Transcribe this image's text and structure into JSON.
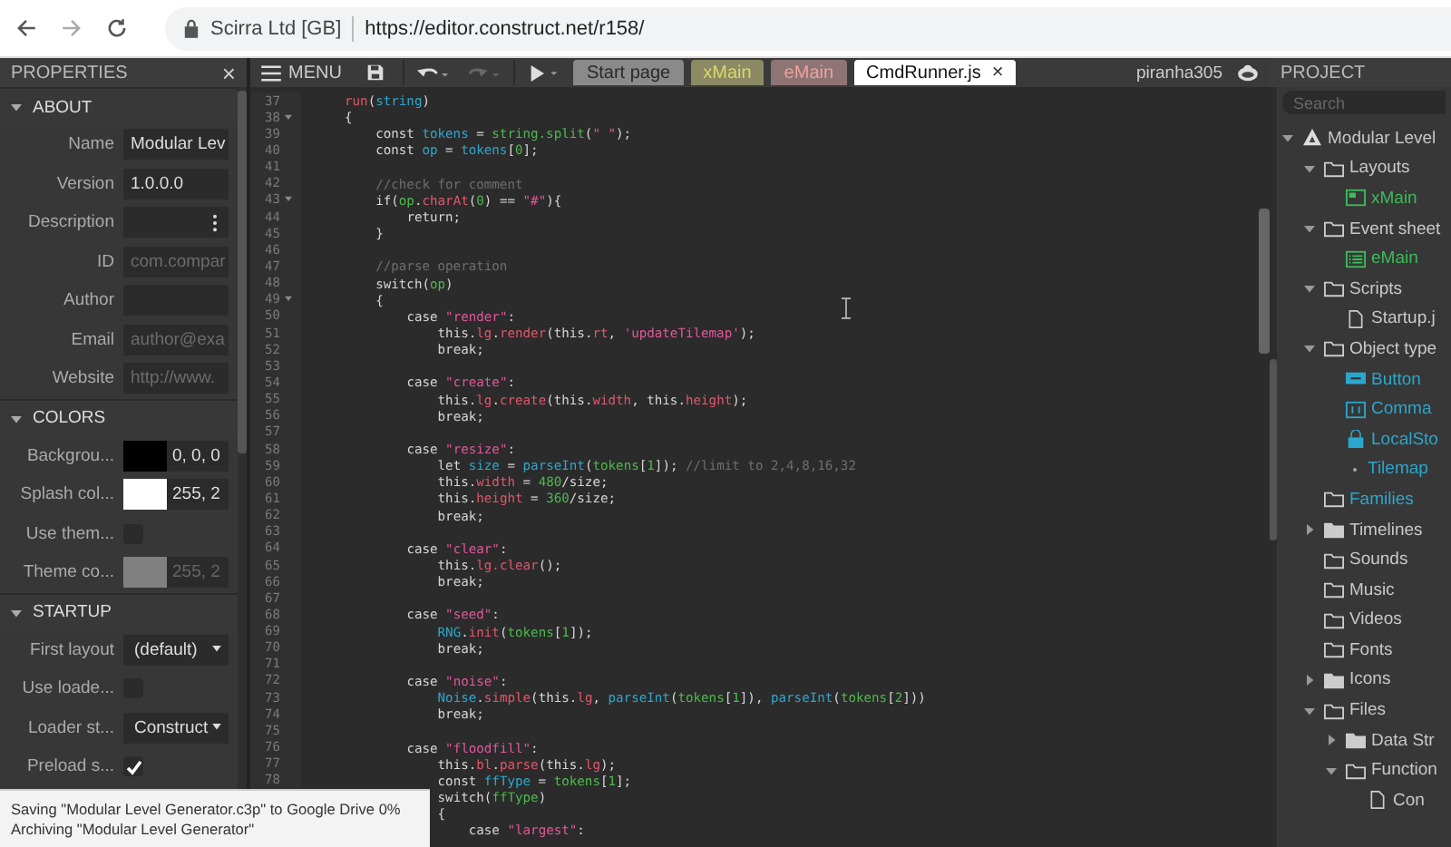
{
  "browser": {
    "site": "Scirra Ltd [GB]",
    "url": "https://editor.construct.net/r158/"
  },
  "properties": {
    "title": "PROPERTIES",
    "close": "×",
    "sections": [
      {
        "title": "ABOUT",
        "expanded": true,
        "rows": [
          {
            "label": "Name",
            "kind": "text",
            "value": "Modular Lev"
          },
          {
            "label": "Version",
            "kind": "text",
            "value": "1.0.0.0"
          },
          {
            "label": "Description",
            "kind": "menu"
          },
          {
            "label": "ID",
            "kind": "text",
            "placeholder": "com.compar"
          },
          {
            "label": "Author",
            "kind": "text"
          },
          {
            "label": "Email",
            "kind": "text",
            "placeholder": "author@exa"
          },
          {
            "label": "Website",
            "kind": "text",
            "placeholder": "http://www."
          }
        ]
      },
      {
        "title": "COLORS",
        "expanded": true,
        "rows": [
          {
            "label": "Backgrou...",
            "kind": "color",
            "color": "#000000",
            "value": "0, 0, 0",
            "disabled": false
          },
          {
            "label": "Splash col...",
            "kind": "color",
            "color": "#ffffff",
            "value": "255, 2",
            "disabled": false
          },
          {
            "label": "Use them...",
            "kind": "checkbox",
            "checked": false
          },
          {
            "label": "Theme co...",
            "kind": "color",
            "color": "#808080",
            "value": "255, 2",
            "disabled": true
          }
        ]
      },
      {
        "title": "STARTUP",
        "expanded": true,
        "rows": [
          {
            "label": "First layout",
            "kind": "dropdown",
            "value": "(default)"
          },
          {
            "label": "Use loade...",
            "kind": "checkbox",
            "checked": false
          },
          {
            "label": "Loader st...",
            "kind": "dropdown",
            "value": "Construct"
          },
          {
            "label": "Preload s...",
            "kind": "checkbox",
            "checked": true
          }
        ]
      }
    ]
  },
  "toolbar": {
    "menu": "MENU",
    "undo_enabled": true,
    "redo_enabled": false
  },
  "tabs": [
    {
      "label": "Start page",
      "kind": "page",
      "selected": false
    },
    {
      "label": "xMain",
      "kind": "layout",
      "selected": false
    },
    {
      "label": "eMain",
      "kind": "eventsheet",
      "selected": false
    },
    {
      "label": "CmdRunner.js",
      "kind": "script",
      "selected": true,
      "close": "×"
    }
  ],
  "user": "piranha305",
  "code": [
    {
      "number": "37",
      "tokens": [
        {
          "kind": "member",
          "text": "run"
        },
        {
          "kind": "plain",
          "text": "("
        },
        {
          "kind": "identifier",
          "text": "string"
        },
        {
          "kind": "plain",
          "text": ")"
        }
      ]
    },
    {
      "number": "38",
      "fold": true,
      "tokens": [
        {
          "kind": "plain",
          "text": "{"
        }
      ]
    },
    {
      "number": "39",
      "tokens": [
        {
          "kind": "plain",
          "text": "    const "
        },
        {
          "kind": "identifier",
          "text": "tokens"
        },
        {
          "kind": "plain",
          "text": " = "
        },
        {
          "kind": "reference",
          "text": "string.split"
        },
        {
          "kind": "plain",
          "text": "("
        },
        {
          "kind": "string",
          "text": "\" \""
        },
        {
          "kind": "plain",
          "text": ");"
        }
      ]
    },
    {
      "number": "40",
      "tokens": [
        {
          "kind": "plain",
          "text": "    const "
        },
        {
          "kind": "identifier",
          "text": "op"
        },
        {
          "kind": "plain",
          "text": " = "
        },
        {
          "kind": "identifier",
          "text": "tokens"
        },
        {
          "kind": "plain",
          "text": "["
        },
        {
          "kind": "number",
          "text": "0"
        },
        {
          "kind": "plain",
          "text": "];"
        }
      ]
    },
    {
      "number": "41"
    },
    {
      "number": "42",
      "tokens": [
        {
          "kind": "comment",
          "text": "    //check for comment"
        }
      ]
    },
    {
      "number": "43",
      "fold": true,
      "tokens": [
        {
          "kind": "plain",
          "text": "    if("
        },
        {
          "kind": "reference",
          "text": "op"
        },
        {
          "kind": "plain",
          "text": "."
        },
        {
          "kind": "member",
          "text": "charAt"
        },
        {
          "kind": "plain",
          "text": "("
        },
        {
          "kind": "number",
          "text": "0"
        },
        {
          "kind": "plain",
          "text": ") == "
        },
        {
          "kind": "string",
          "text": "\"#\""
        },
        {
          "kind": "plain",
          "text": "){"
        }
      ]
    },
    {
      "number": "44",
      "tokens": [
        {
          "kind": "plain",
          "text": "        return;"
        }
      ]
    },
    {
      "number": "45",
      "tokens": [
        {
          "kind": "plain",
          "text": "    }"
        }
      ]
    },
    {
      "number": "46"
    },
    {
      "number": "47",
      "tokens": [
        {
          "kind": "comment",
          "text": "    //parse operation"
        }
      ]
    },
    {
      "number": "48",
      "tokens": [
        {
          "kind": "plain",
          "text": "    switch("
        },
        {
          "kind": "reference",
          "text": "op"
        },
        {
          "kind": "plain",
          "text": ")"
        }
      ]
    },
    {
      "number": "49",
      "fold": true,
      "tokens": [
        {
          "kind": "plain",
          "text": "    {"
        }
      ]
    },
    {
      "number": "50",
      "tokens": [
        {
          "kind": "plain",
          "text": "        case "
        },
        {
          "kind": "string",
          "text": "\"render\""
        },
        {
          "kind": "plain",
          "text": ":"
        }
      ]
    },
    {
      "number": "51",
      "tokens": [
        {
          "kind": "plain",
          "text": "            this."
        },
        {
          "kind": "member",
          "text": "lg"
        },
        {
          "kind": "plain",
          "text": "."
        },
        {
          "kind": "member",
          "text": "render"
        },
        {
          "kind": "plain",
          "text": "(this."
        },
        {
          "kind": "member",
          "text": "rt"
        },
        {
          "kind": "plain",
          "text": ", "
        },
        {
          "kind": "string",
          "text": "'updateTilemap'"
        },
        {
          "kind": "plain",
          "text": ");"
        }
      ]
    },
    {
      "number": "52",
      "tokens": [
        {
          "kind": "plain",
          "text": "            break;"
        }
      ]
    },
    {
      "number": "53"
    },
    {
      "number": "54",
      "tokens": [
        {
          "kind": "plain",
          "text": "        case "
        },
        {
          "kind": "string",
          "text": "\"create\""
        },
        {
          "kind": "plain",
          "text": ":"
        }
      ]
    },
    {
      "number": "55",
      "tokens": [
        {
          "kind": "plain",
          "text": "            this."
        },
        {
          "kind": "member",
          "text": "lg"
        },
        {
          "kind": "plain",
          "text": "."
        },
        {
          "kind": "member",
          "text": "create"
        },
        {
          "kind": "plain",
          "text": "(this."
        },
        {
          "kind": "member",
          "text": "width"
        },
        {
          "kind": "plain",
          "text": ", this."
        },
        {
          "kind": "member",
          "text": "height"
        },
        {
          "kind": "plain",
          "text": ");"
        }
      ]
    },
    {
      "number": "56",
      "tokens": [
        {
          "kind": "plain",
          "text": "            break;"
        }
      ]
    },
    {
      "number": "57"
    },
    {
      "number": "58",
      "tokens": [
        {
          "kind": "plain",
          "text": "        case "
        },
        {
          "kind": "string",
          "text": "\"resize\""
        },
        {
          "kind": "plain",
          "text": ":"
        }
      ]
    },
    {
      "number": "59",
      "tokens": [
        {
          "kind": "plain",
          "text": "            let "
        },
        {
          "kind": "identifier",
          "text": "size"
        },
        {
          "kind": "plain",
          "text": " = "
        },
        {
          "kind": "identifier",
          "text": "parseInt"
        },
        {
          "kind": "plain",
          "text": "("
        },
        {
          "kind": "reference",
          "text": "tokens"
        },
        {
          "kind": "plain",
          "text": "["
        },
        {
          "kind": "number",
          "text": "1"
        },
        {
          "kind": "plain",
          "text": "]); "
        },
        {
          "kind": "comment",
          "text": "//limit to 2,4,8,16,32"
        }
      ]
    },
    {
      "number": "60",
      "tokens": [
        {
          "kind": "plain",
          "text": "            this."
        },
        {
          "kind": "member",
          "text": "width"
        },
        {
          "kind": "plain",
          "text": " = "
        },
        {
          "kind": "number",
          "text": "480"
        },
        {
          "kind": "plain",
          "text": "/size;"
        }
      ]
    },
    {
      "number": "61",
      "tokens": [
        {
          "kind": "plain",
          "text": "            this."
        },
        {
          "kind": "member",
          "text": "height"
        },
        {
          "kind": "plain",
          "text": " = "
        },
        {
          "kind": "number",
          "text": "360"
        },
        {
          "kind": "plain",
          "text": "/size;"
        }
      ]
    },
    {
      "number": "62",
      "tokens": [
        {
          "kind": "plain",
          "text": "            break;"
        }
      ]
    },
    {
      "number": "63"
    },
    {
      "number": "64",
      "tokens": [
        {
          "kind": "plain",
          "text": "        case "
        },
        {
          "kind": "string",
          "text": "\"clear\""
        },
        {
          "kind": "plain",
          "text": ":"
        }
      ]
    },
    {
      "number": "65",
      "tokens": [
        {
          "kind": "plain",
          "text": "            this."
        },
        {
          "kind": "member",
          "text": "lg.clear"
        },
        {
          "kind": "plain",
          "text": "();"
        }
      ]
    },
    {
      "number": "66",
      "tokens": [
        {
          "kind": "plain",
          "text": "            break;"
        }
      ]
    },
    {
      "number": "67"
    },
    {
      "number": "68",
      "tokens": [
        {
          "kind": "plain",
          "text": "        case "
        },
        {
          "kind": "string",
          "text": "\"seed\""
        },
        {
          "kind": "plain",
          "text": ":"
        }
      ]
    },
    {
      "number": "69",
      "tokens": [
        {
          "kind": "identifier",
          "text": "            RNG"
        },
        {
          "kind": "plain",
          "text": "."
        },
        {
          "kind": "member",
          "text": "init"
        },
        {
          "kind": "plain",
          "text": "("
        },
        {
          "kind": "reference",
          "text": "tokens"
        },
        {
          "kind": "plain",
          "text": "["
        },
        {
          "kind": "number",
          "text": "1"
        },
        {
          "kind": "plain",
          "text": "]);"
        }
      ]
    },
    {
      "number": "70",
      "tokens": [
        {
          "kind": "plain",
          "text": "            break;"
        }
      ]
    },
    {
      "number": "71"
    },
    {
      "number": "72",
      "tokens": [
        {
          "kind": "plain",
          "text": "        case "
        },
        {
          "kind": "string",
          "text": "\"noise\""
        },
        {
          "kind": "plain",
          "text": ":"
        }
      ]
    },
    {
      "number": "73",
      "tokens": [
        {
          "kind": "identifier",
          "text": "            Noise"
        },
        {
          "kind": "plain",
          "text": "."
        },
        {
          "kind": "member",
          "text": "simple"
        },
        {
          "kind": "plain",
          "text": "(this."
        },
        {
          "kind": "member",
          "text": "lg"
        },
        {
          "kind": "plain",
          "text": ", "
        },
        {
          "kind": "identifier",
          "text": "parseInt"
        },
        {
          "kind": "plain",
          "text": "("
        },
        {
          "kind": "reference",
          "text": "tokens"
        },
        {
          "kind": "plain",
          "text": "["
        },
        {
          "kind": "number",
          "text": "1"
        },
        {
          "kind": "plain",
          "text": "]), "
        },
        {
          "kind": "identifier",
          "text": "parseInt"
        },
        {
          "kind": "plain",
          "text": "("
        },
        {
          "kind": "reference",
          "text": "tokens"
        },
        {
          "kind": "plain",
          "text": "["
        },
        {
          "kind": "number",
          "text": "2"
        },
        {
          "kind": "plain",
          "text": "]))"
        }
      ]
    },
    {
      "number": "74",
      "tokens": [
        {
          "kind": "plain",
          "text": "            break;"
        }
      ]
    },
    {
      "number": "75"
    },
    {
      "number": "76",
      "tokens": [
        {
          "kind": "plain",
          "text": "        case "
        },
        {
          "kind": "string",
          "text": "\"floodfill\""
        },
        {
          "kind": "plain",
          "text": ":"
        }
      ]
    },
    {
      "number": "77",
      "tokens": [
        {
          "kind": "plain",
          "text": "            this."
        },
        {
          "kind": "member",
          "text": "bl"
        },
        {
          "kind": "plain",
          "text": "."
        },
        {
          "kind": "member",
          "text": "parse"
        },
        {
          "kind": "plain",
          "text": "(this."
        },
        {
          "kind": "member",
          "text": "lg"
        },
        {
          "kind": "plain",
          "text": ");"
        }
      ]
    },
    {
      "number": "78",
      "tokens": [
        {
          "kind": "plain",
          "text": "            const "
        },
        {
          "kind": "identifier",
          "text": "ffType"
        },
        {
          "kind": "plain",
          "text": " = "
        },
        {
          "kind": "reference",
          "text": "tokens"
        },
        {
          "kind": "plain",
          "text": "["
        },
        {
          "kind": "number",
          "text": "1"
        },
        {
          "kind": "plain",
          "text": "];"
        }
      ]
    },
    {
      "tokens": [
        {
          "kind": "plain",
          "text": "            switch("
        },
        {
          "kind": "reference",
          "text": "ffType"
        },
        {
          "kind": "plain",
          "text": ")"
        }
      ]
    },
    {
      "tokens": [
        {
          "kind": "plain",
          "text": "            {"
        }
      ]
    },
    {
      "tokens": [
        {
          "kind": "plain",
          "text": "                case "
        },
        {
          "kind": "string",
          "text": "\"largest\""
        },
        {
          "kind": "plain",
          "text": ":"
        }
      ]
    }
  ],
  "project": {
    "title": "PROJECT",
    "search": {
      "placeholder": "Search"
    },
    "tree": [
      {
        "label": "Modular Level",
        "kind": "project",
        "expanded": true,
        "children": [
          {
            "label": "Layouts",
            "kind": "folder",
            "expanded": true,
            "children": [
              {
                "label": "xMain",
                "kind": "layout",
                "color": "#3dbb5a"
              }
            ]
          },
          {
            "label": "Event sheet",
            "kind": "folder",
            "expanded": true,
            "children": [
              {
                "label": "eMain",
                "kind": "eventsheet",
                "color": "#3dbb5a"
              }
            ]
          },
          {
            "label": "Scripts",
            "kind": "folder",
            "expanded": true,
            "children": [
              {
                "label": "Startup.j",
                "kind": "file"
              }
            ]
          },
          {
            "label": "Object type",
            "kind": "folder",
            "expanded": true,
            "children": [
              {
                "label": "Button",
                "kind": "button",
                "color": "#2ba6cc"
              },
              {
                "label": "Comma",
                "kind": "text",
                "color": "#2ba6cc"
              },
              {
                "label": "LocalSto",
                "kind": "storage",
                "color": "#2ba6cc"
              },
              {
                "label": "Tilemap",
                "kind": "tilemap",
                "color": "#2ba6cc"
              }
            ]
          },
          {
            "label": "Families",
            "kind": "folder",
            "color": "#2ba6cc"
          },
          {
            "label": "Timelines",
            "kind": "folder",
            "expanded": false
          },
          {
            "label": "Sounds",
            "kind": "folder"
          },
          {
            "label": "Music",
            "kind": "folder"
          },
          {
            "label": "Videos",
            "kind": "folder"
          },
          {
            "label": "Fonts",
            "kind": "folder"
          },
          {
            "label": "Icons",
            "kind": "folder",
            "expanded": false
          },
          {
            "label": "Files",
            "kind": "folder",
            "expanded": true,
            "children": [
              {
                "label": "Data Str",
                "kind": "folder",
                "expanded": false
              },
              {
                "label": "Function",
                "kind": "folder",
                "expanded": true,
                "children": [
                  {
                    "label": "Con",
                    "kind": "file"
                  }
                ]
              }
            ]
          }
        ]
      }
    ]
  },
  "toast": [
    "Saving \"Modular Level Generator.c3p\" to Google Drive 0%",
    "Archiving \"Modular Level Generator\""
  ]
}
